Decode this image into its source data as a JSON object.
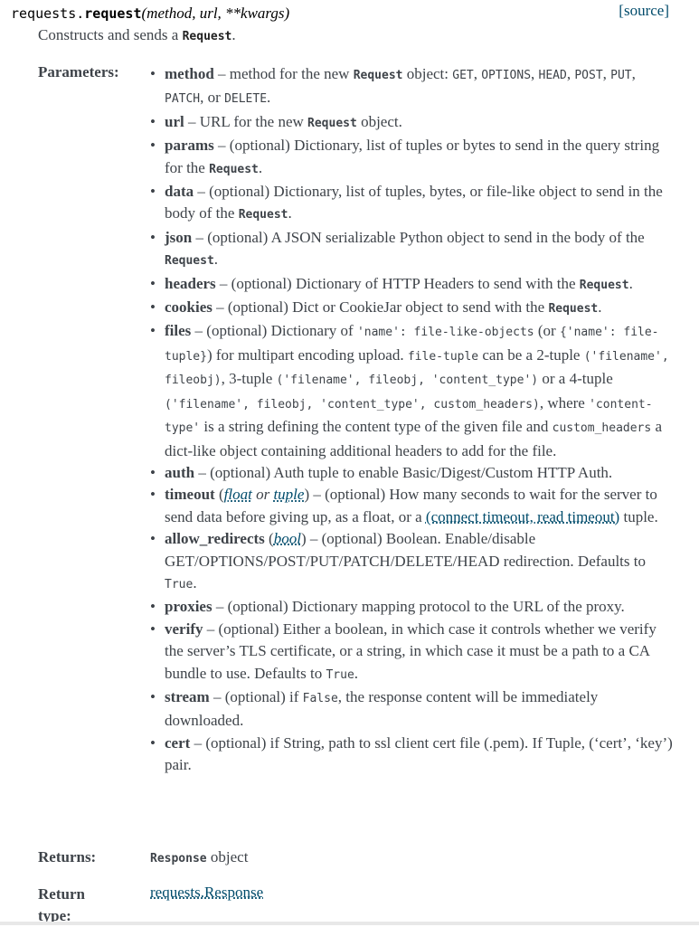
{
  "signature": {
    "module": "requests.",
    "name": "request",
    "params": "(method, url, **kwargs)",
    "source_label": "[source]"
  },
  "description": {
    "text": "Constructs and sends a ",
    "code": "Request",
    "end": "."
  },
  "labels": {
    "parameters": "Parameters:",
    "returns": "Returns:",
    "return_type": "Return type:"
  },
  "returns": {
    "code": "Response",
    "text": " object"
  },
  "return_type": "requests.Response",
  "parameters": [
    {
      "name": "method",
      "segments": [
        {
          "t": " – method for the new "
        },
        {
          "c": "Request",
          "b": true
        },
        {
          "t": " object: "
        },
        {
          "c": "GET"
        },
        {
          "t": ", "
        },
        {
          "c": "OPTIONS"
        },
        {
          "t": ", "
        },
        {
          "c": "HEAD"
        },
        {
          "t": ", "
        },
        {
          "c": "POST"
        },
        {
          "t": ", "
        },
        {
          "c": "PUT"
        },
        {
          "t": ", "
        },
        {
          "c": "PATCH"
        },
        {
          "t": ", or "
        },
        {
          "c": "DELETE"
        },
        {
          "t": "."
        }
      ]
    },
    {
      "name": "url",
      "segments": [
        {
          "t": " – URL for the new "
        },
        {
          "c": "Request",
          "b": true
        },
        {
          "t": " object."
        }
      ]
    },
    {
      "name": "params",
      "segments": [
        {
          "t": " – (optional) Dictionary, list of tuples or bytes to send in the query string for the "
        },
        {
          "c": "Request",
          "b": true
        },
        {
          "t": "."
        }
      ]
    },
    {
      "name": "data",
      "segments": [
        {
          "t": " – (optional) Dictionary, list of tuples, bytes, or file-like object to send in the body of the "
        },
        {
          "c": "Request",
          "b": true
        },
        {
          "t": "."
        }
      ]
    },
    {
      "name": "json",
      "segments": [
        {
          "t": " – (optional) A JSON serializable Python object to send in the body of the "
        },
        {
          "c": "Request",
          "b": true
        },
        {
          "t": "."
        }
      ]
    },
    {
      "name": "headers",
      "segments": [
        {
          "t": " – (optional) Dictionary of HTTP Headers to send with the "
        },
        {
          "c": "Request",
          "b": true
        },
        {
          "t": "."
        }
      ]
    },
    {
      "name": "cookies",
      "segments": [
        {
          "t": " – (optional) Dict or CookieJar object to send with the "
        },
        {
          "c": "Request",
          "b": true
        },
        {
          "t": "."
        }
      ]
    },
    {
      "name": "files",
      "segments": [
        {
          "t": " – (optional) Dictionary of "
        },
        {
          "c": "'name': file-like-objects"
        },
        {
          "t": " (or "
        },
        {
          "c": "{'name': file-tuple}"
        },
        {
          "t": ") for multipart encoding upload. "
        },
        {
          "c": "file-tuple"
        },
        {
          "t": " can be a 2-tuple "
        },
        {
          "c": "('filename', fileobj)"
        },
        {
          "t": ", 3-tuple "
        },
        {
          "c": "('filename', fileobj, 'content_type')"
        },
        {
          "t": " or a 4-tuple "
        },
        {
          "c": "('filename', fileobj, 'content_type', custom_headers)"
        },
        {
          "t": ", where "
        },
        {
          "c": "'content-type'"
        },
        {
          "t": " is a string defining the content type of the given file and "
        },
        {
          "c": "custom_headers"
        },
        {
          "t": " a dict-like object containing additional headers to add for the file."
        }
      ]
    },
    {
      "name": "auth",
      "segments": [
        {
          "t": " – (optional) Auth tuple to enable Basic/Digest/Custom HTTP Auth."
        }
      ]
    },
    {
      "name": "timeout",
      "segments": [
        {
          "t": " ("
        },
        {
          "l": "float",
          "i": true
        },
        {
          "ti": " or "
        },
        {
          "l": "tuple",
          "i": true
        },
        {
          "t": ") – (optional) How many seconds to wait for the server to send data before giving up, as a float, or a "
        },
        {
          "l": "(connect timeout, read timeout)"
        },
        {
          "t": " tuple."
        }
      ]
    },
    {
      "name": "allow_redirects",
      "segments": [
        {
          "t": " ("
        },
        {
          "l": "bool",
          "i": true
        },
        {
          "t": ") – (optional) Boolean. Enable/disable GET/OPTIONS/POST/PUT/PATCH/DELETE/HEAD redirection. Defaults to "
        },
        {
          "c": "True"
        },
        {
          "t": "."
        }
      ]
    },
    {
      "name": "proxies",
      "segments": [
        {
          "t": " – (optional) Dictionary mapping protocol to the URL of the proxy."
        }
      ]
    },
    {
      "name": "verify",
      "segments": [
        {
          "t": " – (optional) Either a boolean, in which case it controls whether we verify the server’s TLS certificate, or a string, in which case it must be a path to a CA bundle to use. Defaults to "
        },
        {
          "c": "True"
        },
        {
          "t": "."
        }
      ]
    },
    {
      "name": "stream",
      "segments": [
        {
          "t": " – (optional) if "
        },
        {
          "c": "False"
        },
        {
          "t": ", the response content will be immediately downloaded."
        }
      ]
    },
    {
      "name": "cert",
      "segments": [
        {
          "t": " – (optional) if String, path to ssl client cert file (.pem). If Tuple, (‘cert’, ‘key’) pair."
        }
      ]
    }
  ]
}
